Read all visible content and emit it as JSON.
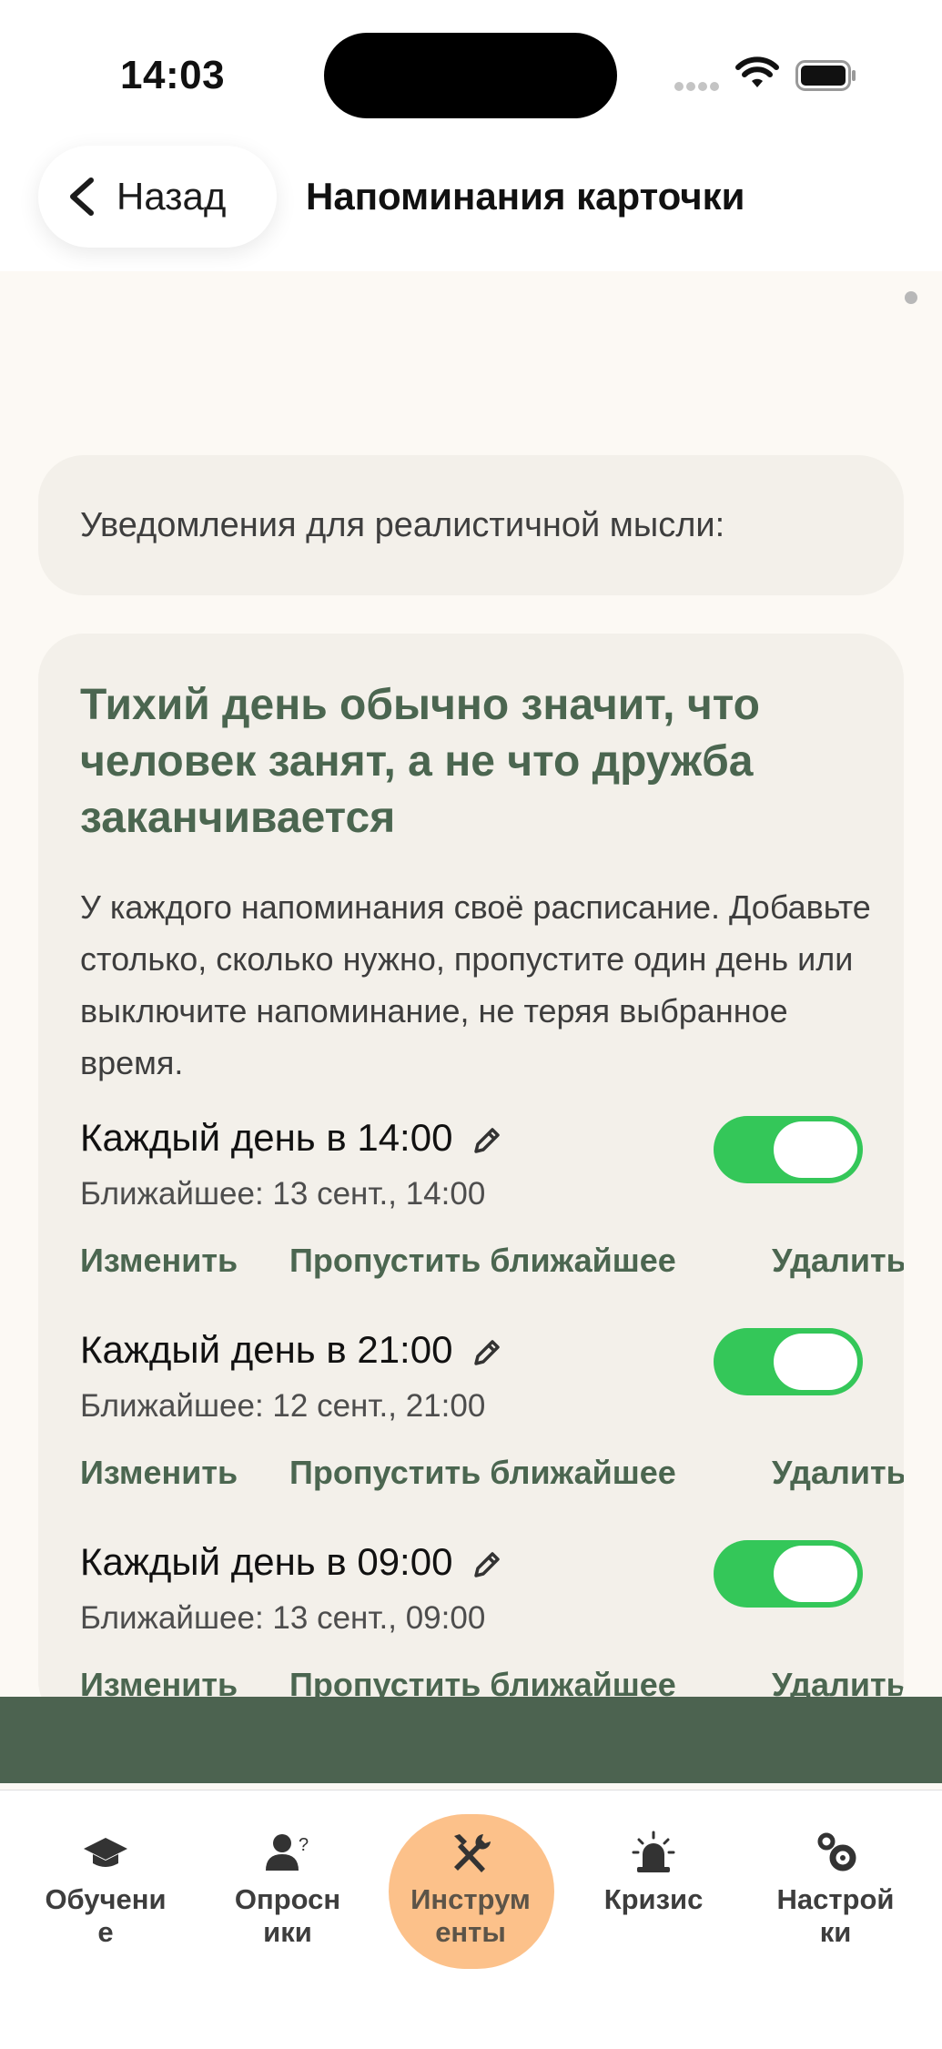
{
  "status": {
    "time": "14:03"
  },
  "header": {
    "back_label": "Назад",
    "title": "Напоминания карточки"
  },
  "notif_section": {
    "label": "Уведомления для реалистичной мысли:"
  },
  "card": {
    "title": "Тихий день обычно значит, что человек занят, а не что дружба заканчивается",
    "description": "У каждого напоминания своё расписание. Добавьте столько, сколько нужно, пропустите один день или выключите напоминание, не теряя выбранное время.",
    "reminders": [
      {
        "title": "Каждый день в 14:00",
        "next": "Ближайшее: 13 сент., 14:00",
        "enabled": true
      },
      {
        "title": "Каждый день в 21:00",
        "next": "Ближайшее: 12 сент., 21:00",
        "enabled": true
      },
      {
        "title": "Каждый день в 09:00",
        "next": "Ближайшее: 13 сент., 09:00",
        "enabled": true
      }
    ],
    "actions": {
      "edit": "Изменить",
      "skip": "Пропустить ближайшее",
      "delete": "Удалить"
    }
  },
  "tabs": [
    {
      "label": "Обучени\nе",
      "icon": "graduation-cap-icon"
    },
    {
      "label": "Опросн\nики",
      "icon": "person-question-icon"
    },
    {
      "label": "Инструм\nенты",
      "icon": "tools-icon",
      "active": true
    },
    {
      "label": "Кризис",
      "icon": "siren-icon"
    },
    {
      "label": "Настрой\nки",
      "icon": "gears-icon"
    }
  ],
  "colors": {
    "accent_green": "#4b6650",
    "toggle_on": "#34c759",
    "active_tab": "#fcc18a",
    "banner": "#4c6350"
  }
}
